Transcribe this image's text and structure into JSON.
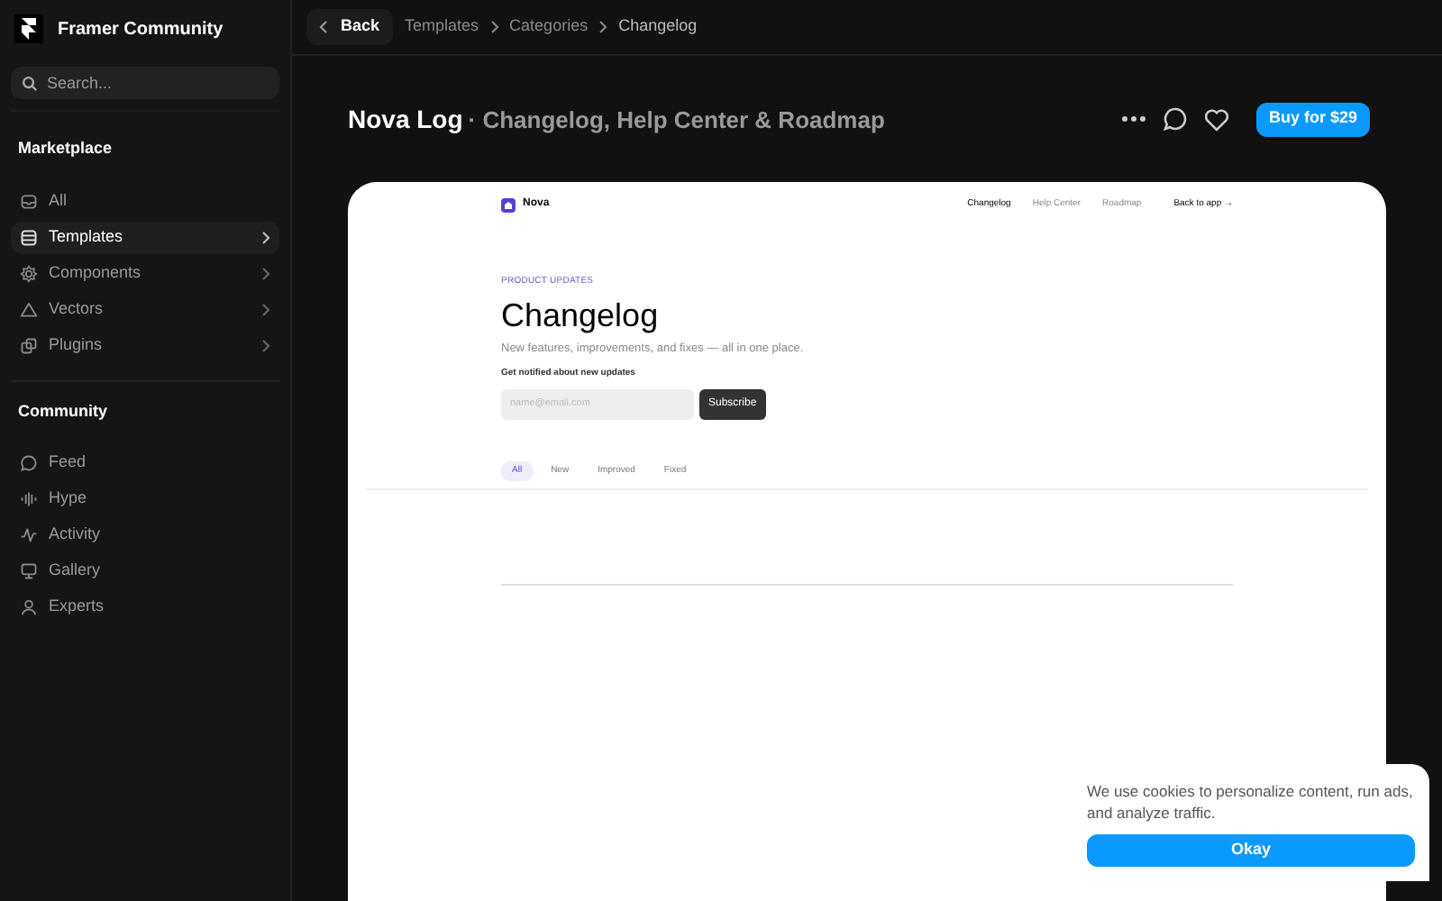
{
  "sidebar": {
    "brand": "Framer Community",
    "search": {
      "placeholder": "Search..."
    },
    "sections": [
      {
        "title": "Marketplace",
        "items": [
          {
            "label": "All",
            "kind": "inbox",
            "selected": false,
            "has_arrow": false
          },
          {
            "label": "Templates",
            "kind": "layout",
            "selected": true,
            "has_arrow": true
          },
          {
            "label": "Components",
            "kind": "gear",
            "selected": false,
            "has_arrow": true
          },
          {
            "label": "Vectors",
            "kind": "triangle",
            "selected": false,
            "has_arrow": true
          },
          {
            "label": "Plugins",
            "kind": "squares",
            "selected": false,
            "has_arrow": true
          }
        ]
      },
      {
        "title": "Community",
        "items": [
          {
            "label": "Feed",
            "kind": "bubble",
            "selected": false,
            "has_arrow": false
          },
          {
            "label": "Hype",
            "kind": "bars",
            "selected": false,
            "has_arrow": false
          },
          {
            "label": "Activity",
            "kind": "pulse",
            "selected": false,
            "has_arrow": false
          },
          {
            "label": "Gallery",
            "kind": "monitor",
            "selected": false,
            "has_arrow": false
          },
          {
            "label": "Experts",
            "kind": "person",
            "selected": false,
            "has_arrow": false
          }
        ]
      }
    ]
  },
  "topbar": {
    "back": "Back",
    "breadcrumbs": [
      "Templates",
      "Categories",
      "Changelog"
    ]
  },
  "product": {
    "name": "Nova Log",
    "subtitle": "· Changelog, Help Center & Roadmap",
    "buy": "Buy for $29"
  },
  "preview": {
    "logo": "Nova",
    "nav": [
      {
        "label": "Changelog",
        "selected": true
      },
      {
        "label": "Help Center",
        "selected": false
      },
      {
        "label": "Roadmap",
        "selected": false
      }
    ],
    "back_link": "Back to app →",
    "eyebrow": "PRODUCT UPDATES",
    "heading": "Changelog",
    "lead": "New features, improvements, and fixes — all in one place.",
    "notify": "Get notified about new updates",
    "email": {
      "placeholder": "name@email.com"
    },
    "subscribe": "Subscribe",
    "filters": [
      {
        "label": "All",
        "selected": true
      },
      {
        "label": "New",
        "selected": false
      },
      {
        "label": "Improved",
        "selected": false
      },
      {
        "label": "Fixed",
        "selected": false
      }
    ]
  },
  "cookie": {
    "text": "We use cookies to personalize content, run ads, and analyze traffic.",
    "button": "Okay"
  }
}
